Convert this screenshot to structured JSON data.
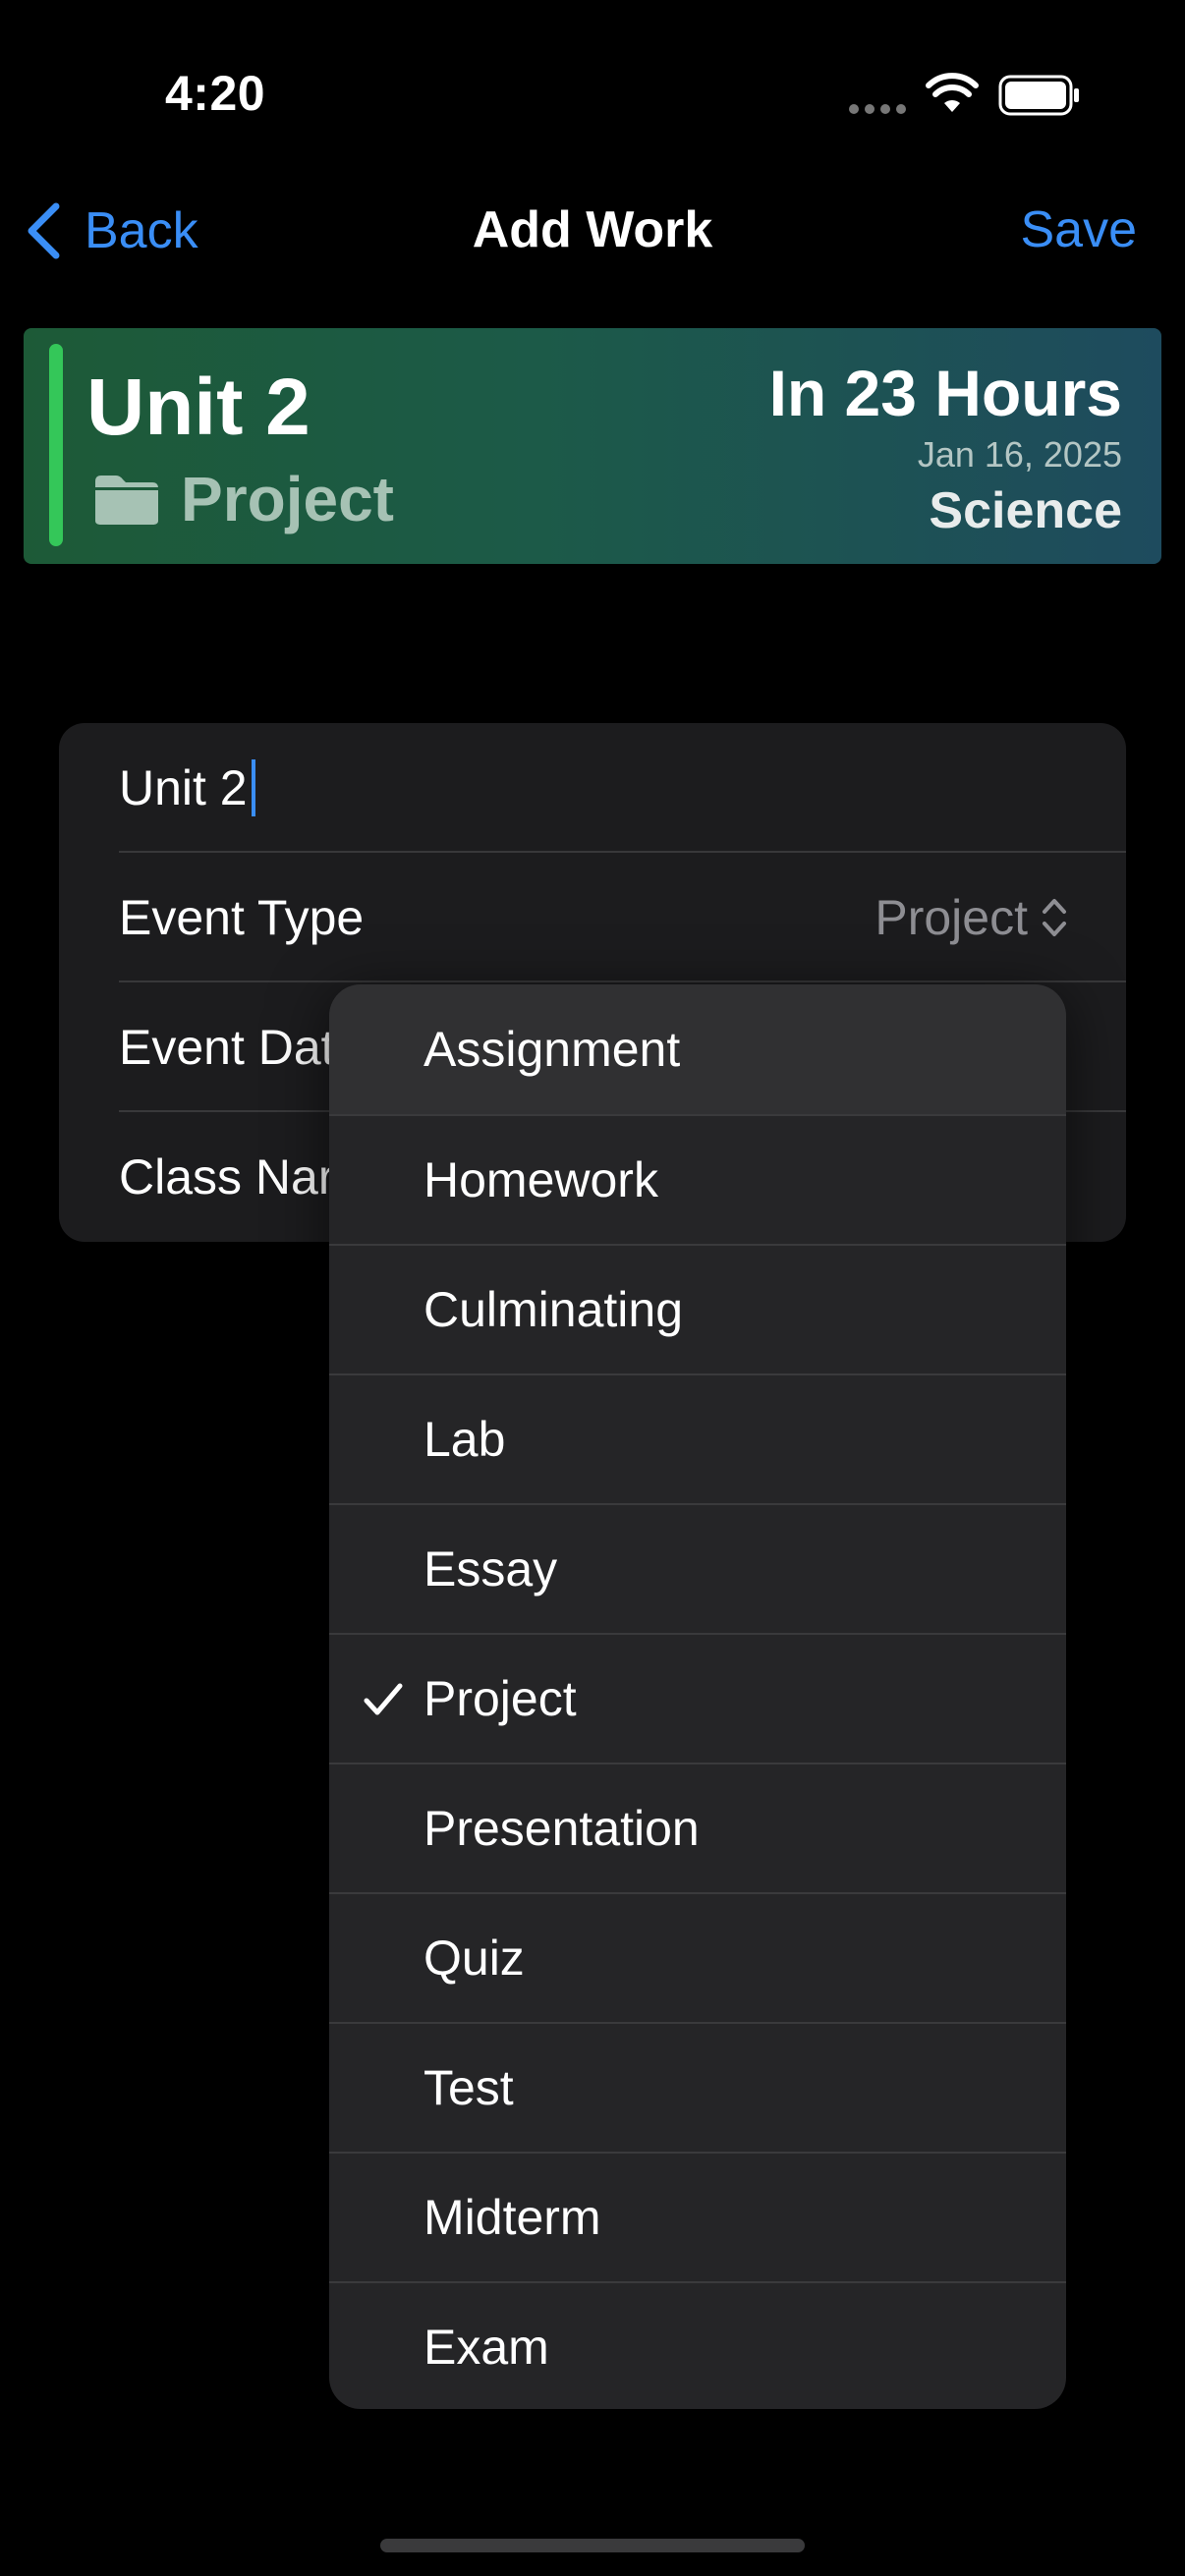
{
  "status_bar": {
    "time": "4:20"
  },
  "nav": {
    "back_label": "Back",
    "title": "Add Work",
    "save_label": "Save"
  },
  "event_card": {
    "title": "Unit 2",
    "type": "Project",
    "due": "In 23 Hours",
    "date": "Jan 16, 2025",
    "class_name": "Science",
    "accent_color": "#34c759"
  },
  "form": {
    "name_value": "Unit 2",
    "rows": [
      {
        "label": "Event Type",
        "value": "Project"
      },
      {
        "label": "Event Dat"
      },
      {
        "label": "Class Nar"
      }
    ]
  },
  "menu": {
    "selected": "Project",
    "items": [
      "Assignment",
      "Homework",
      "Culminating",
      "Lab",
      "Essay",
      "Project",
      "Presentation",
      "Quiz",
      "Test",
      "Midterm",
      "Exam"
    ]
  },
  "colors": {
    "accent_blue": "#3a8ef6",
    "background": "#000000",
    "menu_bg": "#252527",
    "form_bg": "#1c1c1e"
  }
}
